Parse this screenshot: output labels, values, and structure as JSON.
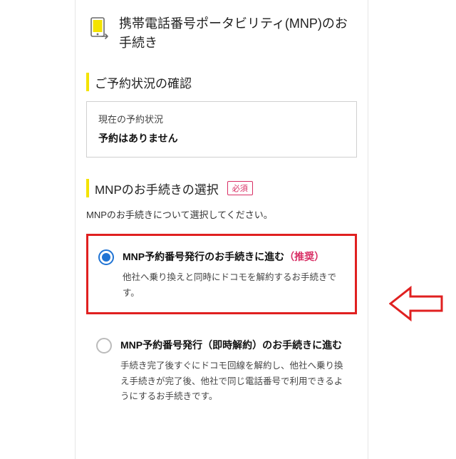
{
  "header": {
    "title": "携帯電話番号ポータビリティ(MNP)のお手続き"
  },
  "status": {
    "section_title": "ご予約状況の確認",
    "label": "現在の予約状況",
    "value": "予約はありません"
  },
  "selection": {
    "section_title": "MNPのお手続きの選択",
    "required_label": "必須",
    "description": "MNPのお手続きについて選択してください。",
    "options": [
      {
        "title": "MNP予約番号発行のお手続きに進む",
        "recommended_label": "（推奨）",
        "desc": "他社へ乗り換えと同時にドコモを解約するお手続きです。"
      },
      {
        "title": "MNP予約番号発行（即時解約）のお手続きに進む",
        "desc": "手続き完了後すぐにドコモ回線を解約し、他社へ乗り換え手続きが完了後、他社で同じ電話番号で利用できるようにするお手続きです。"
      }
    ]
  }
}
